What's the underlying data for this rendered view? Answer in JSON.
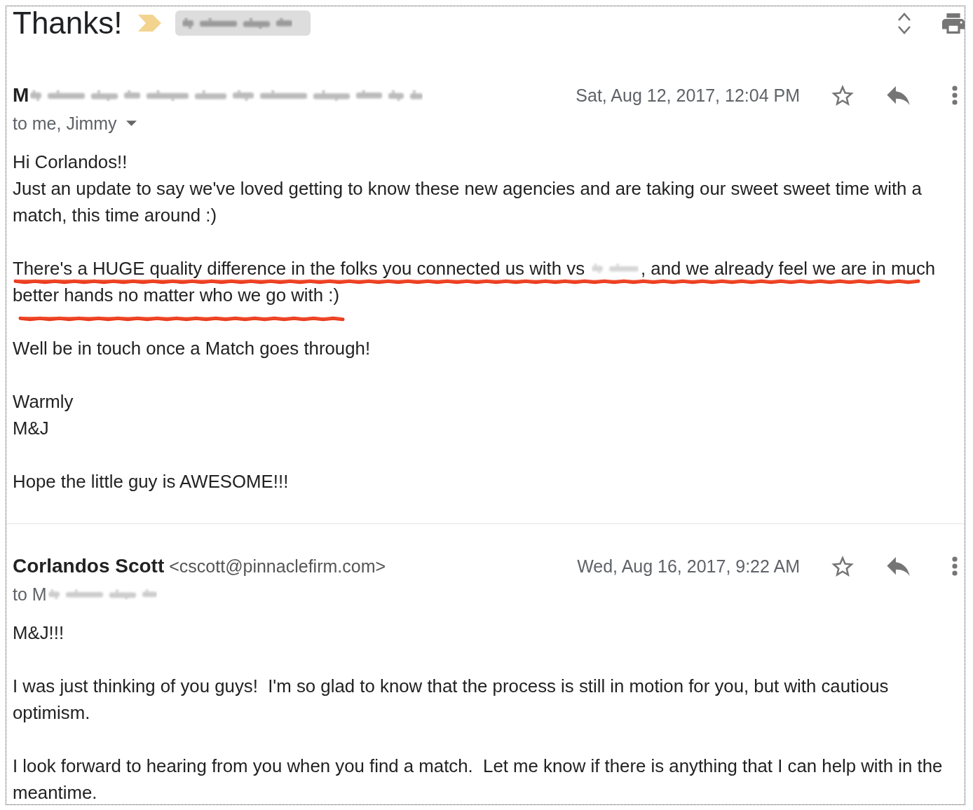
{
  "thread": {
    "subject": "Thanks!",
    "important": true,
    "labels": [
      {
        "redacted": true
      }
    ]
  },
  "messages": [
    {
      "sender": {
        "name": "M",
        "redacted": true
      },
      "date": "Sat, Aug 12, 2017, 12:04 PM",
      "starred": false,
      "recipients": {
        "text": "to me, Jimmy",
        "redacted": false,
        "caret": true
      },
      "body": [
        {
          "underlined": false,
          "lines": [
            {
              "kind": "text",
              "text": "Hi Corlandos!!"
            },
            {
              "kind": "text",
              "text": "Just an update to say we've loved getting to know these new agencies and are taking our sweet sweet time with a match, this time around :)"
            }
          ]
        },
        {
          "underlined": true,
          "lines": [
            {
              "kind": "mixed",
              "parts": [
                {
                  "kind": "text",
                  "text": "There's a HUGE quality difference in the folks you connected us with vs"
                },
                {
                  "kind": "redacted"
                },
                {
                  "kind": "text",
                  "text": ", and we already feel we are in much"
                }
              ]
            },
            {
              "kind": "text",
              "text": "better hands no matter who we go with :)"
            }
          ]
        },
        {
          "underlined": false,
          "lines": [
            {
              "kind": "text",
              "text": "Well be in touch once a Match goes through!"
            }
          ]
        },
        {
          "underlined": false,
          "lines": [
            {
              "kind": "text",
              "text": "Warmly"
            },
            {
              "kind": "text",
              "text": "M&J"
            }
          ]
        },
        {
          "underlined": false,
          "lines": [
            {
              "kind": "text",
              "text": "Hope the little guy is AWESOME!!!"
            }
          ]
        }
      ]
    },
    {
      "sender": {
        "name": "Corlandos Scott",
        "email": "<cscott@pinnaclefirm.com>",
        "redacted": false
      },
      "date": "Wed, Aug 16, 2017, 9:22 AM",
      "starred": false,
      "recipients": {
        "text": "to M",
        "redacted": true,
        "caret": false
      },
      "body": [
        {
          "underlined": false,
          "lines": [
            {
              "kind": "text",
              "text": "M&J!!!"
            }
          ]
        },
        {
          "underlined": false,
          "lines": [
            {
              "kind": "text",
              "text": "I was just thinking of you guys!  I'm so glad to know that the process is still in motion for you, but with cautious optimism."
            }
          ]
        },
        {
          "underlined": false,
          "lines": [
            {
              "kind": "text",
              "text": "I look forward to hearing from you when you find a match.  Let me know if there is anything that I can help with in the meantime."
            }
          ]
        }
      ]
    }
  ]
}
